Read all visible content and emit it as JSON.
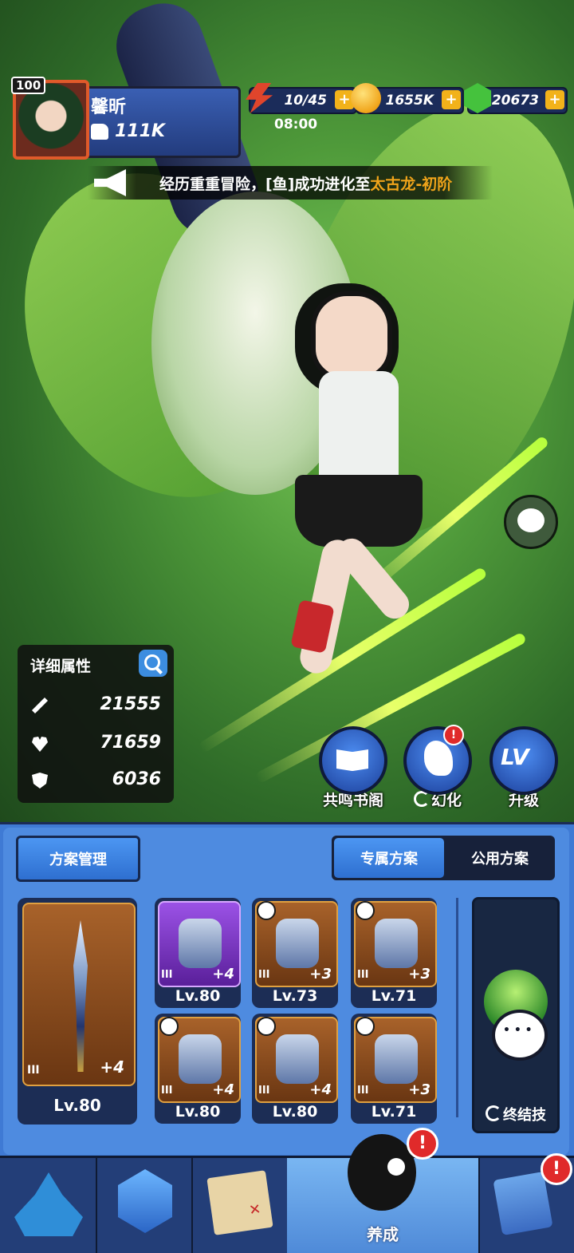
{
  "player": {
    "level": "100",
    "name": "馨昕",
    "power": "111K"
  },
  "resources": {
    "energy": "10/45",
    "energy_timer": "08:00",
    "coins": "1655K",
    "gems": "20673",
    "plus_label": "+"
  },
  "broadcast": {
    "text_prefix": "经历重重冒险，[鱼]成功进化至",
    "text_highlight": "太古龙-初阶"
  },
  "attributes": {
    "title": "详细属性",
    "attack": "21555",
    "hp": "71659",
    "defense": "6036"
  },
  "actions": {
    "codex_label": "共鸣书阁",
    "transform_label": "幻化",
    "upgrade_label": "升级",
    "upgrade_icon_text": "LV",
    "alert": "!"
  },
  "panel": {
    "plan_manage": "方案管理",
    "exclusive_plan": "专属方案",
    "public_plan": "公用方案",
    "ultimate_label": "终结技"
  },
  "equipment": [
    {
      "slot": "weapon",
      "tier": "III",
      "plus": "+4",
      "level": "Lv.80"
    },
    {
      "slot": "helmet",
      "tier": "III",
      "plus": "+4",
      "level": "Lv.80"
    },
    {
      "slot": "armor",
      "tier": "III",
      "plus": "+3",
      "level": "Lv.73"
    },
    {
      "slot": "belt",
      "tier": "III",
      "plus": "+3",
      "level": "Lv.71"
    },
    {
      "slot": "gloves",
      "tier": "III",
      "plus": "+4",
      "level": "Lv.80"
    },
    {
      "slot": "boots",
      "tier": "III",
      "plus": "+4",
      "level": "Lv.80"
    },
    {
      "slot": "necklace",
      "tier": "III",
      "plus": "+3",
      "level": "Lv.71"
    }
  ],
  "nav": {
    "active_label": "养成",
    "alert": "!"
  },
  "colors": {
    "accent_blue": "#4e8be0",
    "highlight_orange": "#f0a41a",
    "alert_red": "#e02a2a"
  }
}
